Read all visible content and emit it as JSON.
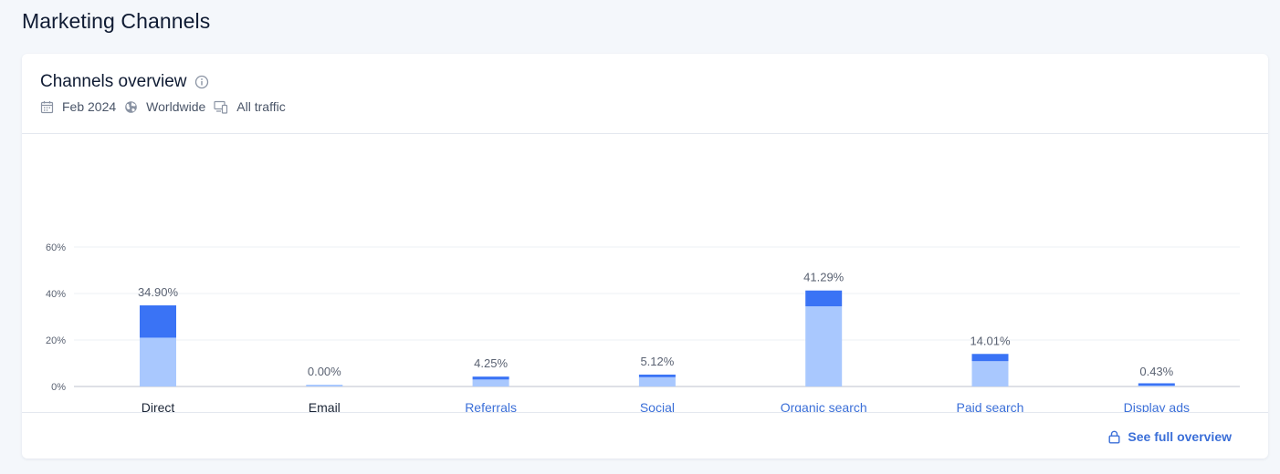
{
  "page": {
    "title": "Marketing Channels"
  },
  "card": {
    "title": "Channels overview",
    "filters": {
      "date": "Feb 2024",
      "region": "Worldwide",
      "traffic": "All traffic"
    },
    "footer_link": "See full overview"
  },
  "colors": {
    "bar_light": "#a9c8fe",
    "bar_dark": "#3a73f5",
    "link": "#3b6fd8",
    "muted_text": "#5a6272",
    "label_dark": "#1b2536"
  },
  "icons": {
    "info": "info-icon",
    "date": "calendar-icon",
    "region": "globe-icon",
    "traffic": "devices-icon",
    "lock": "lock-icon"
  },
  "chart_data": {
    "type": "bar",
    "stacked": true,
    "categories": [
      "Direct",
      "Email",
      "Referrals",
      "Social",
      "Organic search",
      "Paid search",
      "Display ads"
    ],
    "category_links": [
      false,
      false,
      true,
      true,
      true,
      true,
      true
    ],
    "values": [
      34.9,
      0.0,
      4.25,
      5.12,
      41.29,
      14.01,
      0.43
    ],
    "value_labels": [
      "34.90%",
      "0.00%",
      "4.25%",
      "5.12%",
      "41.29%",
      "14.01%",
      "0.43%"
    ],
    "series": [
      {
        "values": [
          21.0,
          0.0,
          3.0,
          4.0,
          34.5,
          10.9,
          0.4
        ]
      },
      {
        "values": [
          13.9,
          0.0,
          1.25,
          1.12,
          6.79,
          3.11,
          0.03
        ]
      }
    ],
    "yticks": [
      "60%",
      "40%",
      "20%",
      "0%"
    ],
    "ytick_values": [
      60,
      40,
      20,
      0
    ],
    "ylim": [
      0,
      60
    ],
    "grid": true,
    "title": "",
    "xlabel": "",
    "ylabel": ""
  }
}
